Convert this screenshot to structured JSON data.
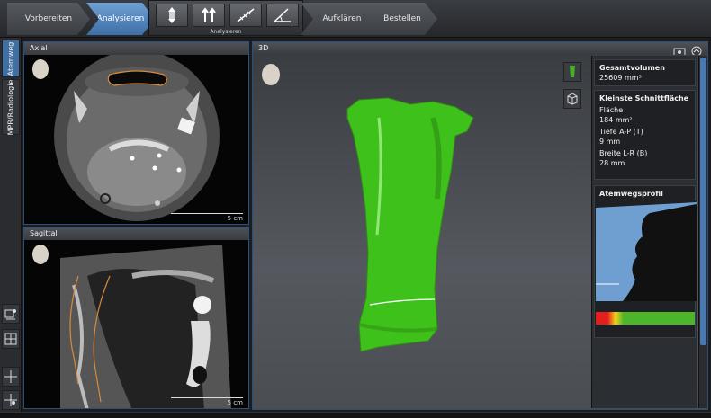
{
  "workflow": {
    "steps": [
      "Vorbereiten",
      "Analysieren",
      "Aufklären",
      "Bestellen"
    ],
    "tools_label": "Analysieren"
  },
  "left_tabs": [
    "Atemweg",
    "MPR/Radiologie"
  ],
  "panels": {
    "axial": {
      "title": "Axial",
      "scale": "5 cm"
    },
    "sagittal": {
      "title": "Sagittal",
      "scale": "5 cm"
    },
    "view3d": {
      "title": "3D"
    }
  },
  "info": {
    "volume": {
      "title": "Gesamtvolumen",
      "value": "25609 mm³"
    },
    "smallest": {
      "title": "Kleinste Schnittfläche",
      "area_label": "Fläche",
      "area_value": "184 mm²",
      "depth_label": "Tiefe A-P (T)",
      "depth_value": "9 mm",
      "width_label": "Breite L-R (B)",
      "width_value": "28 mm"
    },
    "profile": {
      "title": "Atemwegsprofil"
    }
  },
  "colors": {
    "accent": "#3f6fa3",
    "airway": "#3fc11c"
  }
}
